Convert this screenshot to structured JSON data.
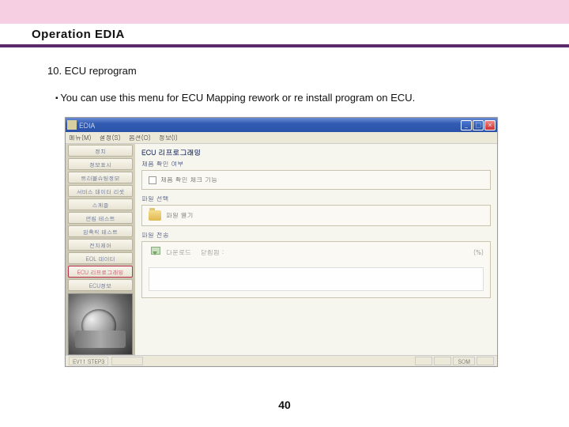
{
  "slide": {
    "title": "Operation EDIA",
    "section": "10. ECU reprogram",
    "bullet": "You can use this menu for ECU Mapping rework or re install program on ECU.",
    "page_number": "40"
  },
  "window": {
    "title": "EDIA",
    "menus": [
      "메뉴(M)",
      "설정(S)",
      "옵션(O)",
      "정보(I)"
    ],
    "min": "_",
    "max": "□",
    "close": "×"
  },
  "sidebar": {
    "items": [
      "정치",
      "정보표시",
      "트러블슈팅정보",
      "서비스 데이터 리셋",
      "스케줄",
      "연립 테스트",
      "압축릭 테스트",
      "전자제어",
      "EOL 데이터",
      "ECU 리프로그래밍",
      "ECU정보"
    ]
  },
  "content": {
    "heading": "ECU 리프로그래밍",
    "group1_label": "제품 확인 여부",
    "checkbox_label": "제품 확인 체크 기능",
    "group2_label": "파일 선택",
    "file_open": "파일 열기",
    "group3_label": "파일 전송",
    "download_label": "다운로드",
    "download_field": "닫힘됨 :",
    "percent": "(%)"
  },
  "statusbar": {
    "left1": "EV11 STEP3",
    "left2": "",
    "right1": "",
    "right2": "",
    "right3": "SOM",
    "right4": ""
  }
}
